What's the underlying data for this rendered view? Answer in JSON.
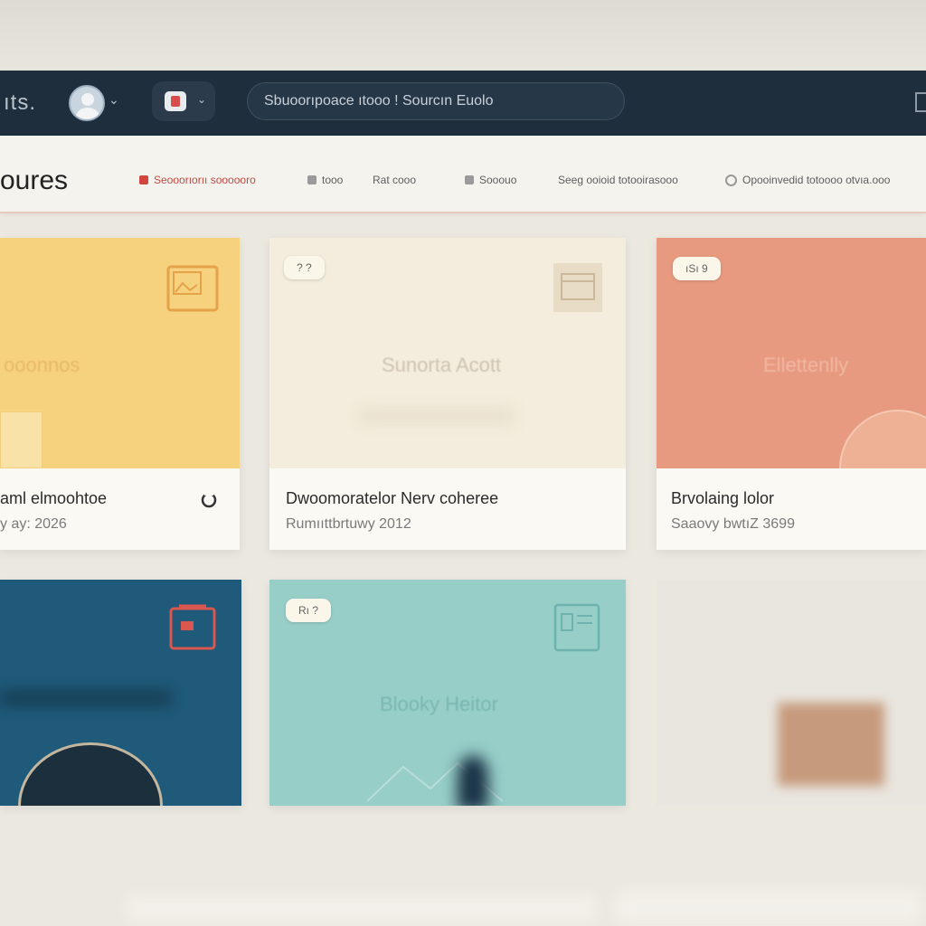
{
  "header": {
    "brand": "ıts.",
    "search_text": "Sbuoorıpoace ıtooo ! Sourcın Euolo"
  },
  "icons": {
    "avatar": "user-avatar-icon",
    "notification": "notification-icon",
    "chevron": "chevron-down-icon"
  },
  "subheader": {
    "title": "oures",
    "items": [
      {
        "label": "Seooorıorıı soooooro",
        "active": true
      },
      {
        "label": "tooo",
        "active": false
      },
      {
        "label": "Rat cooo",
        "active": false
      },
      {
        "label": "Sooouo",
        "active": false
      },
      {
        "label": "Seeg ooioid totooirasooo",
        "active": false
      },
      {
        "label": "Opooinvedid totoooo otvıa.ooo",
        "active": false
      }
    ]
  },
  "cards": [
    {
      "title": "aml elmoohtoe",
      "meta": "y ay: 2026",
      "media_text": "ooonnos",
      "badge": "",
      "color": "#f6d27f"
    },
    {
      "title": "Dwoomoratelor Nerv coheree",
      "meta": "Rumııttbrtuwy 2012",
      "media_text": "Sunorta Acott",
      "badge": "? ?",
      "color": "#f4ecdc"
    },
    {
      "title": "Brvolaing lolor",
      "meta": "Saaovy bwtıZ 3699",
      "media_text": "Ellettenlly",
      "badge": "ıSı 9",
      "color": "#e89a80"
    },
    {
      "title": "",
      "meta": "",
      "media_text": "",
      "badge": "",
      "color": "#1f5a7a"
    },
    {
      "title": "",
      "meta": "",
      "media_text": "Blooky Heitor",
      "badge": "Rı ?",
      "color": "#97cec8"
    }
  ]
}
